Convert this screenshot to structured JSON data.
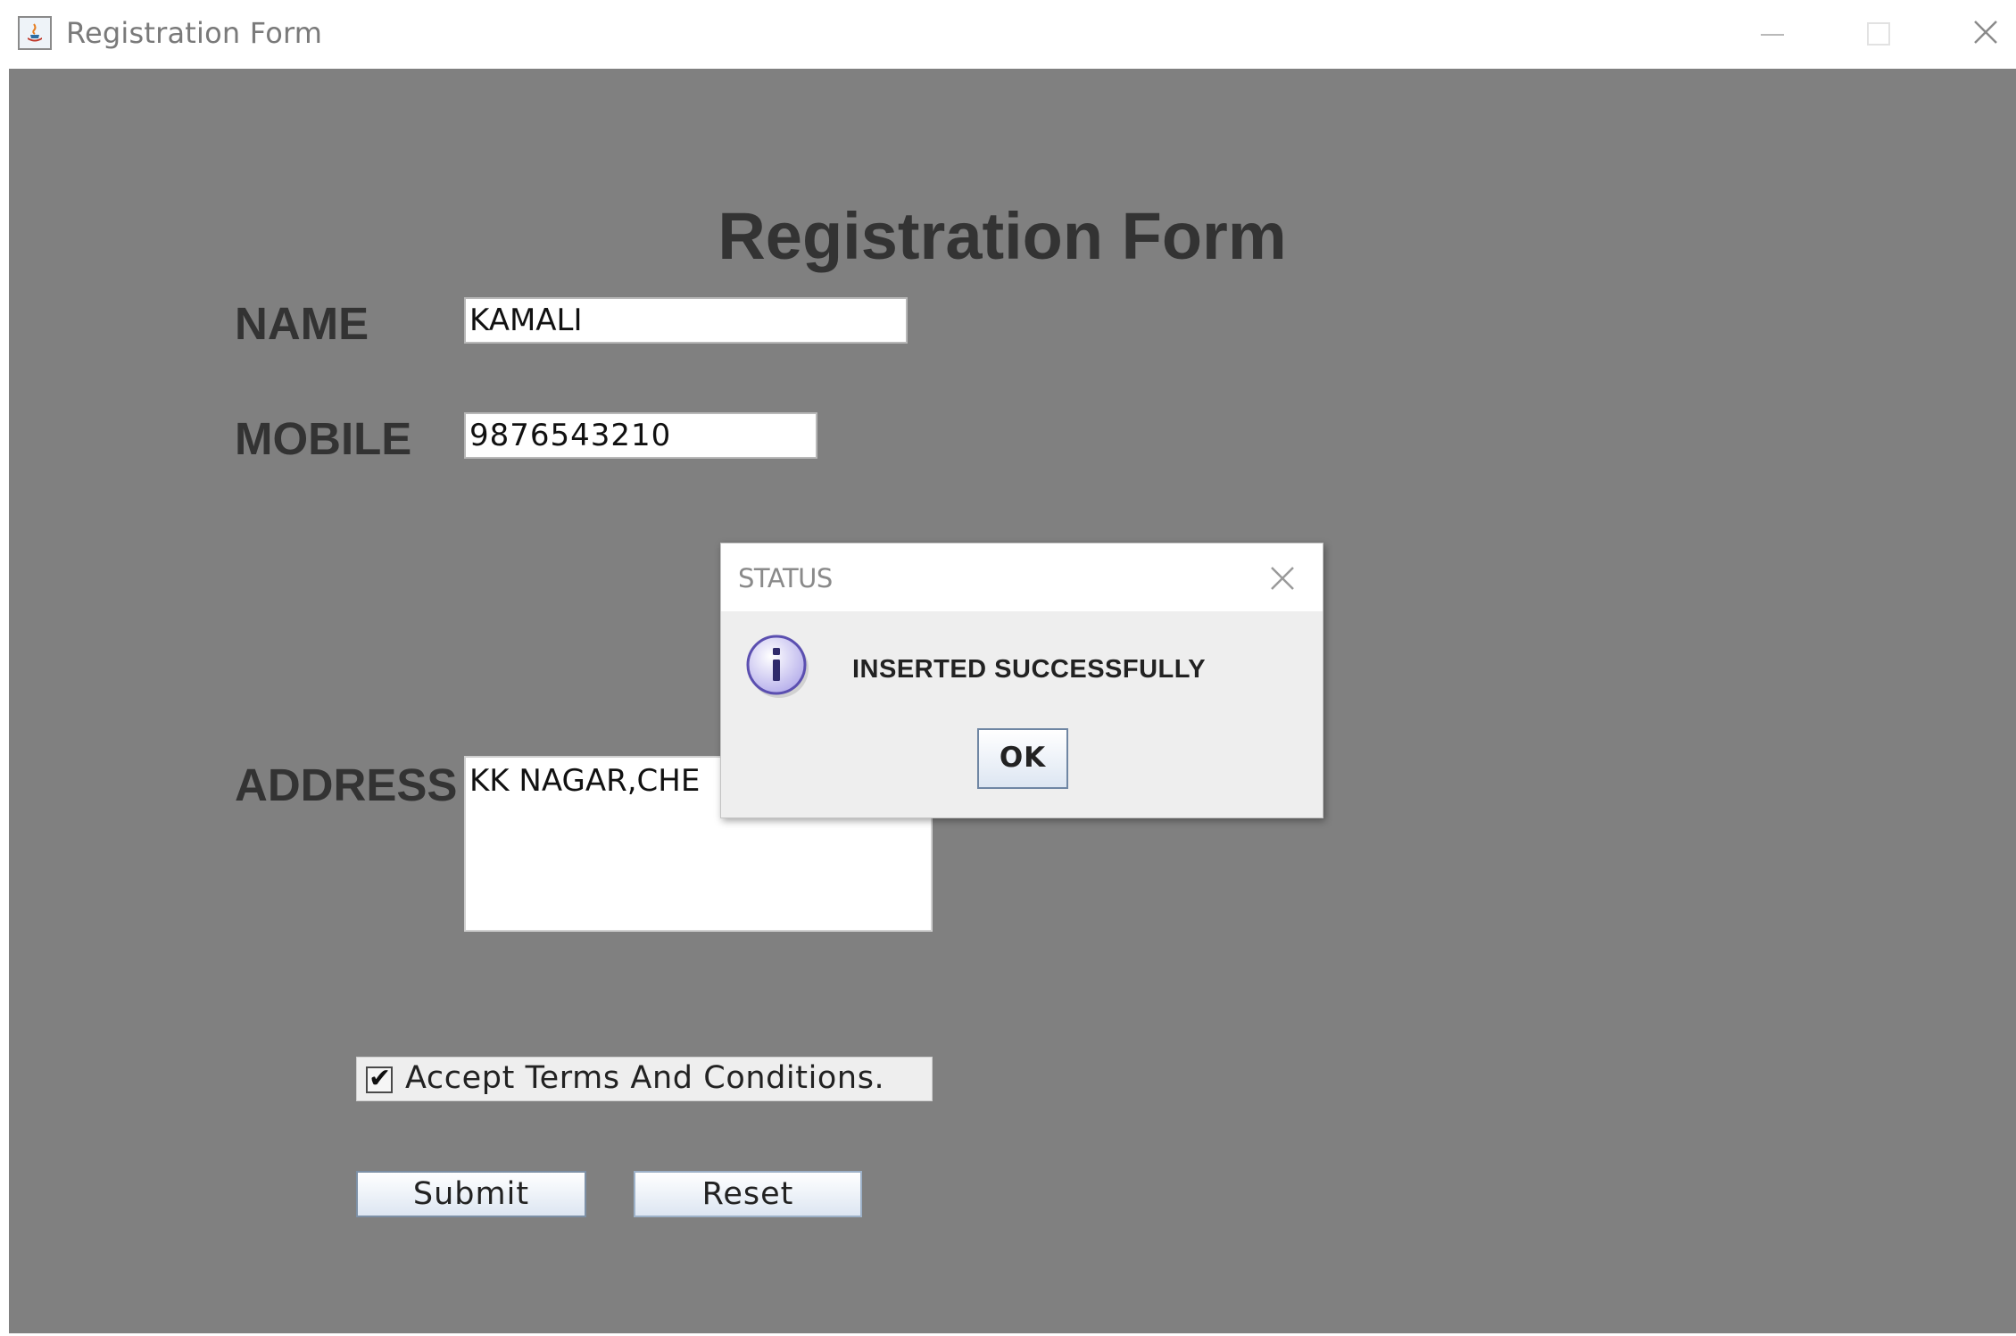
{
  "window": {
    "title": "Registration Form"
  },
  "form": {
    "heading": "Registration Form",
    "name_label": "NAME",
    "name_value": "KAMALI",
    "mobile_label": "MOBILE",
    "mobile_value": "9876543210",
    "address_label": "ADDRESS",
    "address_value": "KK NAGAR,CHE",
    "terms_label": "Accept Terms And Conditions.",
    "terms_checked": true,
    "submit_label": "Submit",
    "reset_label": "Reset"
  },
  "dialog": {
    "title": "STATUS",
    "message": "INSERTED SUCCESSFULLY",
    "ok_label": "OK",
    "icon": "info-icon"
  },
  "colors": {
    "panel_bg": "#808080",
    "label_text": "#333333"
  }
}
